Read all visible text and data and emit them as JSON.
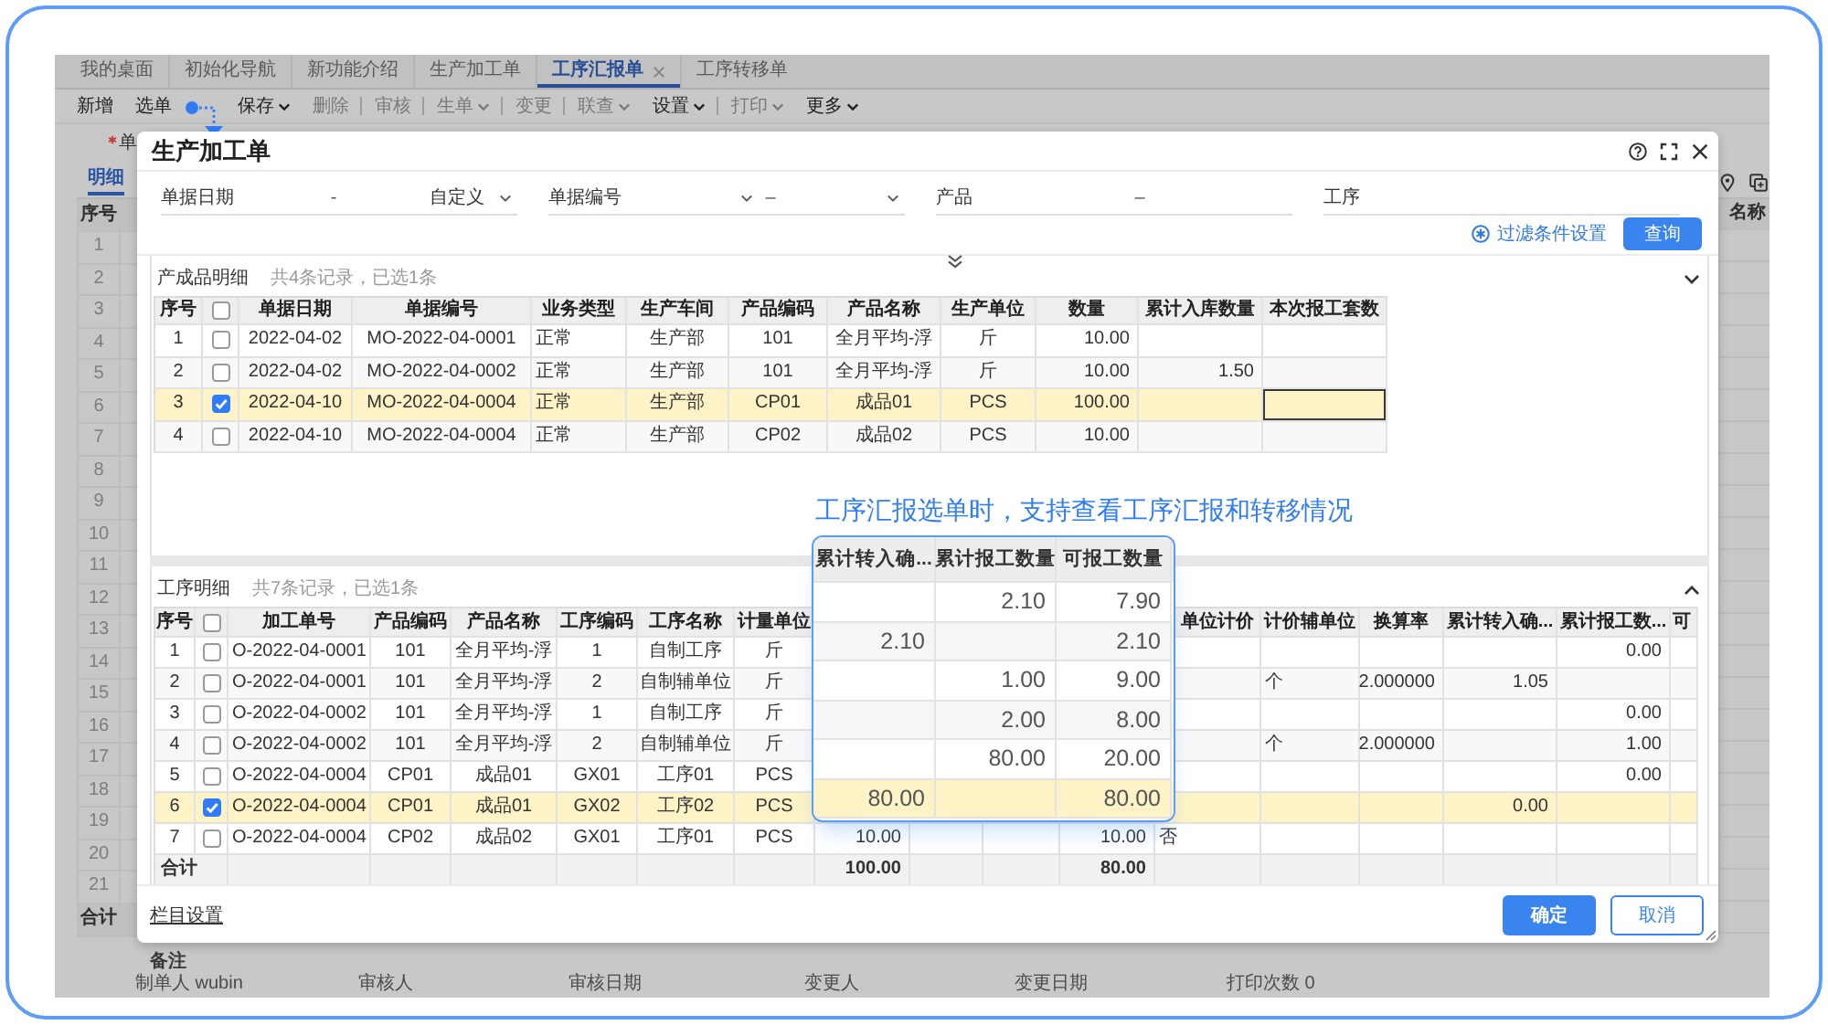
{
  "app": {
    "tabs": [
      {
        "label": "我的桌面",
        "selected": false,
        "closable": false
      },
      {
        "label": "初始化导航",
        "selected": false,
        "closable": false
      },
      {
        "label": "新功能介绍",
        "selected": false,
        "closable": false
      },
      {
        "label": "生产加工单",
        "selected": false,
        "closable": false
      },
      {
        "label": "工序汇报单",
        "selected": true,
        "closable": true
      },
      {
        "label": "工序转移单",
        "selected": false,
        "closable": false
      }
    ],
    "toolbar": [
      {
        "label": "新增",
        "disabled": false,
        "dropdown": false,
        "divider_after": false
      },
      {
        "label": "选单",
        "disabled": false,
        "dropdown": false,
        "divider_after": false
      },
      {
        "label": "保存",
        "disabled": false,
        "dropdown": true,
        "divider_after": false
      },
      {
        "label": "删除",
        "disabled": true,
        "dropdown": false,
        "divider_after": true
      },
      {
        "label": "审核",
        "disabled": true,
        "dropdown": false,
        "divider_after": true
      },
      {
        "label": "生单",
        "disabled": true,
        "dropdown": true,
        "divider_after": true
      },
      {
        "label": "变更",
        "disabled": true,
        "dropdown": false,
        "divider_after": true
      },
      {
        "label": "联查",
        "disabled": true,
        "dropdown": true,
        "divider_after": false
      },
      {
        "label": "设置",
        "disabled": false,
        "dropdown": true,
        "divider_after": true
      },
      {
        "label": "打印",
        "disabled": true,
        "dropdown": true,
        "divider_after": false
      },
      {
        "label": "更多",
        "disabled": false,
        "dropdown": true,
        "divider_after": false
      }
    ],
    "required_label": {
      "text": "单",
      "required": true
    },
    "detail_tab": {
      "label": "明细",
      "selected": true
    },
    "grid": {
      "index_label": "序号",
      "right_label": "名称",
      "row_numbers": [
        "1",
        "2",
        "3",
        "4",
        "5",
        "6",
        "7",
        "8",
        "9",
        "10",
        "11",
        "12",
        "13",
        "14",
        "15",
        "16",
        "17",
        "18",
        "19",
        "20",
        "21"
      ],
      "total_label": "合计"
    },
    "remark_label": "备注",
    "footer": [
      "制单人 wubin",
      "审核人",
      "审核日期",
      "变更人",
      "变更日期",
      "打印次数 0"
    ]
  },
  "annotation": {
    "caption": "工序汇报选单时，支持查看工序汇报和转移情况"
  },
  "dialog": {
    "title": "生产加工单",
    "filters": [
      {
        "label": "单据日期",
        "kind": "date",
        "separator": "-",
        "preset": "自定义"
      },
      {
        "label": "单据编号",
        "kind": "select-range",
        "separator": "–"
      },
      {
        "label": "产品",
        "kind": "range",
        "separator": "–"
      },
      {
        "label": "工序",
        "kind": "text"
      }
    ],
    "filter_settings": "过滤条件设置",
    "query": "查询",
    "upper": {
      "title": "产成品明细",
      "summary": "共4条记录，已选1条",
      "index_label": "序号",
      "all_checked": false,
      "columns": [
        "单据日期",
        "单据编号",
        "业务类型",
        "生产车间",
        "产品编码",
        "产品名称",
        "生产单位",
        "数量",
        "累计入库数量",
        "本次报工套数"
      ],
      "rows": [
        {
          "no": "1",
          "selected": false,
          "editing": false,
          "cells": [
            "2022-04-02",
            "MO-2022-04-0001",
            "正常",
            "生产部",
            "101",
            "全月平均-浮",
            "斤",
            "10.00",
            null,
            null
          ]
        },
        {
          "no": "2",
          "selected": false,
          "editing": false,
          "cells": [
            "2022-04-02",
            "MO-2022-04-0002",
            "正常",
            "生产部",
            "101",
            "全月平均-浮",
            "斤",
            "10.00",
            "1.50",
            null
          ]
        },
        {
          "no": "3",
          "selected": true,
          "editing": true,
          "cells": [
            "2022-04-10",
            "MO-2022-04-0004",
            "正常",
            "生产部",
            "CP01",
            "成品01",
            "PCS",
            "100.00",
            null,
            null
          ]
        },
        {
          "no": "4",
          "selected": false,
          "editing": false,
          "cells": [
            "2022-04-10",
            "MO-2022-04-0004",
            "正常",
            "生产部",
            "CP02",
            "成品02",
            "PCS",
            "10.00",
            null,
            null
          ]
        }
      ]
    },
    "lower": {
      "title": "工序明细",
      "summary": "共7条记录，已选1条",
      "index_label": "序号",
      "all_checked": false,
      "columns": [
        "加工单号",
        "产品编码",
        "产品名称",
        "工序编码",
        "工序名称",
        "计量单位",
        null,
        null,
        null,
        null,
        "单位计价",
        "计价辅单位",
        "换算率",
        "累计转入确...",
        "累计报工数...",
        "可"
      ],
      "rows": [
        {
          "no": "1",
          "selected": false,
          "cells": [
            "O-2022-04-0001",
            "101",
            "全月平均-浮",
            "1",
            "自制工序",
            "斤",
            null,
            null,
            null,
            null,
            null,
            null,
            null,
            null,
            "0.00",
            null
          ]
        },
        {
          "no": "2",
          "selected": false,
          "cells": [
            "O-2022-04-0001",
            "101",
            "全月平均-浮",
            "2",
            "自制辅单位",
            "斤",
            null,
            null,
            null,
            null,
            null,
            "个",
            "2.000000",
            "1.05",
            null,
            null
          ]
        },
        {
          "no": "3",
          "selected": false,
          "cells": [
            "O-2022-04-0002",
            "101",
            "全月平均-浮",
            "1",
            "自制工序",
            "斤",
            null,
            null,
            null,
            null,
            null,
            null,
            null,
            null,
            "0.00",
            null
          ]
        },
        {
          "no": "4",
          "selected": false,
          "cells": [
            "O-2022-04-0002",
            "101",
            "全月平均-浮",
            "2",
            "自制辅单位",
            "斤",
            null,
            null,
            null,
            null,
            null,
            "个",
            "2.000000",
            null,
            "1.00",
            null
          ]
        },
        {
          "no": "5",
          "selected": false,
          "cells": [
            "O-2022-04-0004",
            "CP01",
            "成品01",
            "GX01",
            "工序01",
            "PCS",
            null,
            null,
            null,
            null,
            null,
            null,
            null,
            null,
            "0.00",
            null
          ]
        },
        {
          "no": "6",
          "selected": true,
          "cells": [
            "O-2022-04-0004",
            "CP01",
            "成品01",
            "GX02",
            "工序02",
            "PCS",
            null,
            null,
            null,
            null,
            null,
            null,
            null,
            "0.00",
            null,
            null
          ]
        },
        {
          "no": "7",
          "selected": false,
          "cells": [
            "O-2022-04-0004",
            "CP02",
            "成品02",
            "GX01",
            "工序01",
            "PCS",
            "10.00",
            null,
            null,
            "10.00",
            "否",
            null,
            null,
            null,
            null,
            null
          ]
        }
      ],
      "total": {
        "label": "合计",
        "cells": [
          null,
          null,
          null,
          null,
          null,
          null,
          "100.00",
          null,
          null,
          "80.00",
          null,
          null,
          null,
          null,
          null,
          null
        ]
      }
    },
    "column_settings": "栏目设置",
    "confirm": "确定",
    "cancel": "取消"
  },
  "magnifier": {
    "columns": [
      "累计转入确...",
      "累计报工数量",
      "可报工数量"
    ],
    "rows": [
      {
        "selected": false,
        "cells": [
          null,
          "2.10",
          "7.90"
        ]
      },
      {
        "selected": false,
        "cells": [
          "2.10",
          null,
          "2.10"
        ]
      },
      {
        "selected": false,
        "cells": [
          null,
          "1.00",
          "9.00"
        ]
      },
      {
        "selected": false,
        "cells": [
          null,
          "2.00",
          "8.00"
        ]
      },
      {
        "selected": false,
        "cells": [
          null,
          "80.00",
          "20.00"
        ]
      },
      {
        "selected": true,
        "cells": [
          "80.00",
          null,
          "80.00"
        ]
      }
    ]
  }
}
